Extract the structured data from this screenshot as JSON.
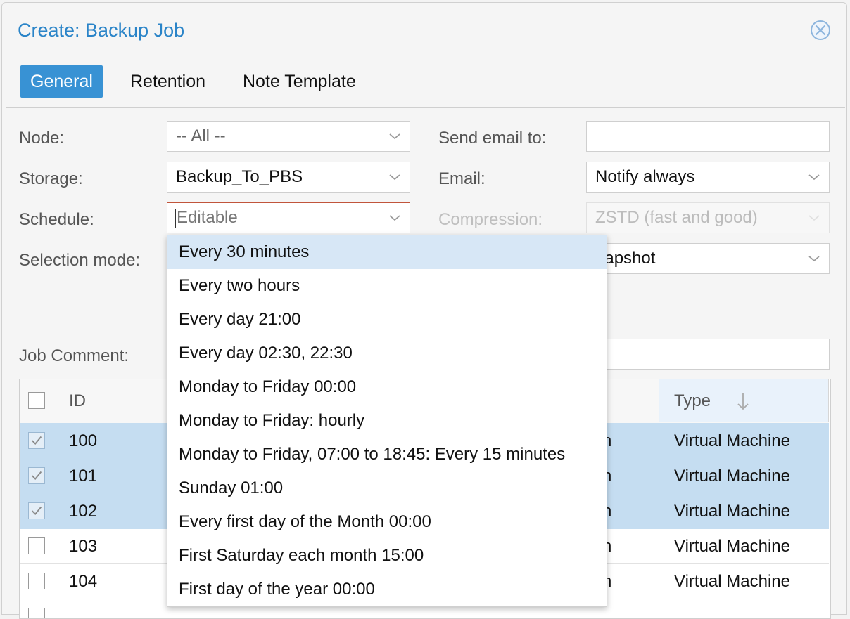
{
  "dialog": {
    "title": "Create: Backup Job",
    "tabs": [
      {
        "label": "General",
        "active": true
      },
      {
        "label": "Retention",
        "active": false
      },
      {
        "label": "Note Template",
        "active": false
      }
    ]
  },
  "form": {
    "node": {
      "label": "Node:",
      "value": "-- All --"
    },
    "storage": {
      "label": "Storage:",
      "value": "Backup_To_PBS"
    },
    "schedule": {
      "label": "Schedule:",
      "placeholder": "Editable"
    },
    "selection_mode": {
      "label": "Selection mode:"
    },
    "send_email": {
      "label": "Send email to:",
      "value": ""
    },
    "email": {
      "label": "Email:",
      "value": "Notify always"
    },
    "compression": {
      "label": "Compression:",
      "value": "ZSTD (fast and good)"
    },
    "mode": {
      "value_visible": "napshot"
    },
    "job_comment": {
      "label": "Job Comment:",
      "value": ""
    }
  },
  "schedule_options": [
    "Every 30 minutes",
    "Every two hours",
    "Every day 21:00",
    "Every day 02:30, 22:30",
    "Monday to Friday 00:00",
    "Monday to Friday: hourly",
    "Monday to Friday, 07:00 to 18:45: Every 15 minutes",
    "Sunday 01:00",
    "Every first day of the Month 00:00",
    "First Saturday each month 15:00",
    "First day of the year 00:00"
  ],
  "grid": {
    "headers": {
      "id": "ID",
      "type": "Type"
    },
    "rows": [
      {
        "id": "100",
        "desc": "n",
        "type": "Virtual Machine",
        "checked": true
      },
      {
        "id": "101",
        "desc": "n",
        "type": "Virtual Machine",
        "checked": true
      },
      {
        "id": "102",
        "desc": "n",
        "type": "Virtual Machine",
        "checked": true
      },
      {
        "id": "103",
        "desc": "n",
        "type": "Virtual Machine",
        "checked": false
      },
      {
        "id": "104",
        "desc": "n",
        "type": "Virtual Machine",
        "checked": false
      }
    ]
  },
  "colors": {
    "accent": "#3892d4",
    "title": "#2a84c8",
    "selected_row": "#c5ddf1",
    "focus_border": "#c1553b"
  }
}
